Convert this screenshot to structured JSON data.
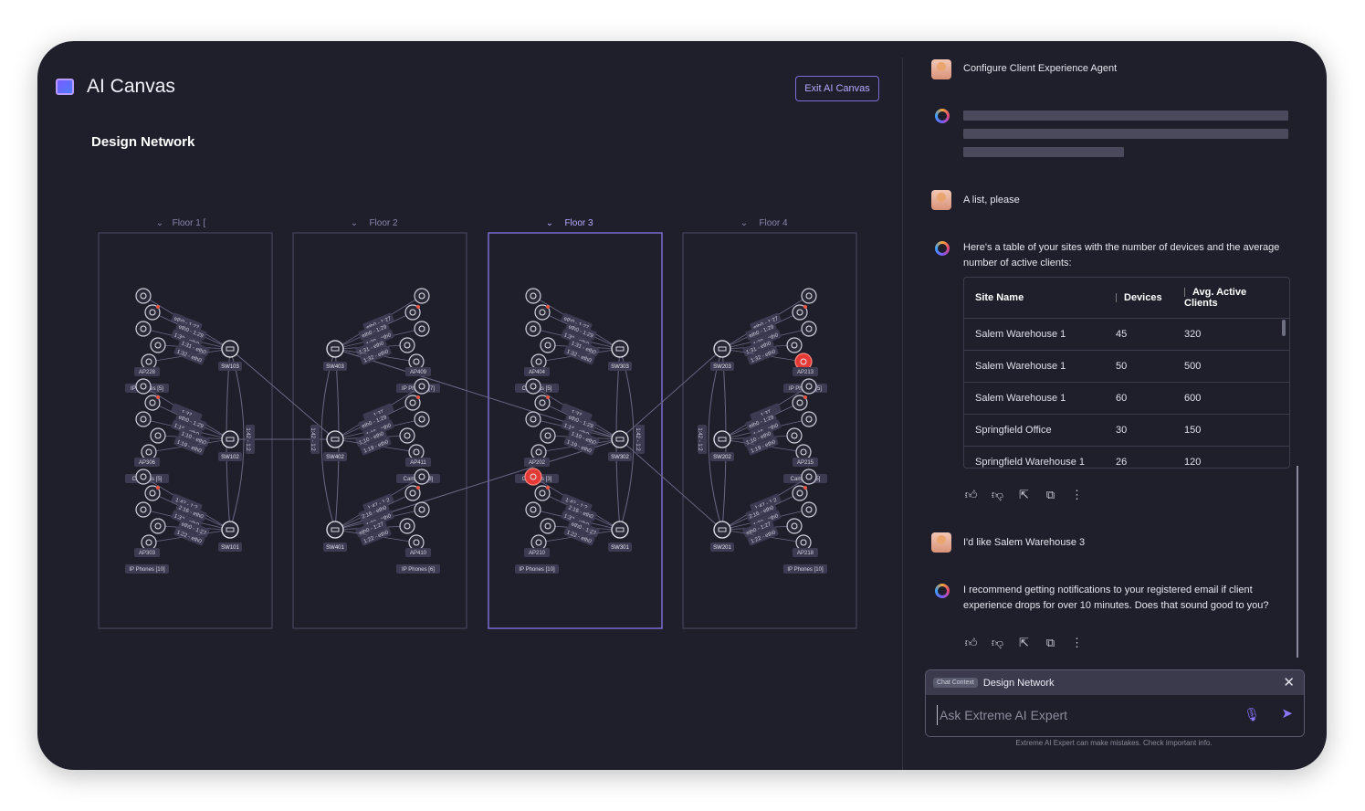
{
  "app": {
    "title": "AI Canvas",
    "exit_label": "Exit AI Canvas",
    "section_title": "Design Network"
  },
  "floors": [
    {
      "label": "Floor 1 [",
      "active": false
    },
    {
      "label": "Floor 2",
      "active": false
    },
    {
      "label": "Floor 3",
      "active": true
    },
    {
      "label": "Floor 4",
      "active": false
    }
  ],
  "diagram": {
    "switches": [
      "SW103",
      "SW102",
      "SW101",
      "SW403",
      "SW402",
      "SW401",
      "SW303",
      "SW302",
      "SW301",
      "SW203",
      "SW202",
      "SW201"
    ],
    "ap_labels": [
      "AP228",
      "AP306",
      "AP303",
      "AP409",
      "AP411",
      "AP410",
      "AP404",
      "AP202",
      "AP210",
      "AP213",
      "AP215",
      "AP218"
    ],
    "group_labels": [
      "IP Phones [5]",
      "Cameras [5]",
      "IP Phones [10]",
      "IP Phones [7]",
      "Cameras [3]",
      "IP Phones [6]",
      "Cameras [5]",
      "Cameras [3]",
      "IP Phones [10]"
    ],
    "link_labels": [
      "eth0 - 1:27",
      "eth0 - 1:29",
      "1:30 - eth0",
      "1:31 - eth0",
      "1:32 - eth0",
      "1:37",
      "eth0 - 1:29",
      "1:16 - eth0",
      "1:10 - eth0",
      "1:19 - eth0",
      "1:42 - 1:2",
      "2:16 - eth0",
      "1:32 - eth0",
      "eth0 - 1:27",
      "1:22 - eth0"
    ],
    "highlight_color": "#e53935",
    "accent_color": "#8b76ff"
  },
  "chat": {
    "messages": [
      {
        "role": "user",
        "text": "Configure Client Experience Agent"
      },
      {
        "role": "ai",
        "loading": true
      },
      {
        "role": "user",
        "text": "A list, please"
      },
      {
        "role": "ai",
        "text": "Here's a table of your sites with the number of devices and the average number of active clients:"
      },
      {
        "role": "user",
        "text": "I'd like Salem Warehouse 3"
      },
      {
        "role": "ai",
        "text": "I recommend getting notifications to your registered email if client experience drops for over 10 minutes. Does that sound good to you?"
      }
    ],
    "table": {
      "headers": [
        "Site Name",
        "Devices",
        "Avg. Active Clients"
      ],
      "rows": [
        [
          "Salem Warehouse 1",
          "45",
          "320"
        ],
        [
          "Salem Warehouse 1",
          "50",
          "500"
        ],
        [
          "Salem Warehouse 1",
          "60",
          "600"
        ],
        [
          "Springfield Office",
          "30",
          "150"
        ],
        [
          "Springfield Warehouse 1",
          "26",
          "120"
        ]
      ]
    },
    "action_icons": [
      "thumbs-up-icon",
      "thumbs-down-icon",
      "share-icon",
      "copy-icon",
      "more-icon"
    ],
    "context_chip": "Chat Context",
    "context_title": "Design Network",
    "input_placeholder": "Ask Extreme AI Expert",
    "disclaimer": "Extreme AI Expert can make mistakes. Check important info."
  }
}
